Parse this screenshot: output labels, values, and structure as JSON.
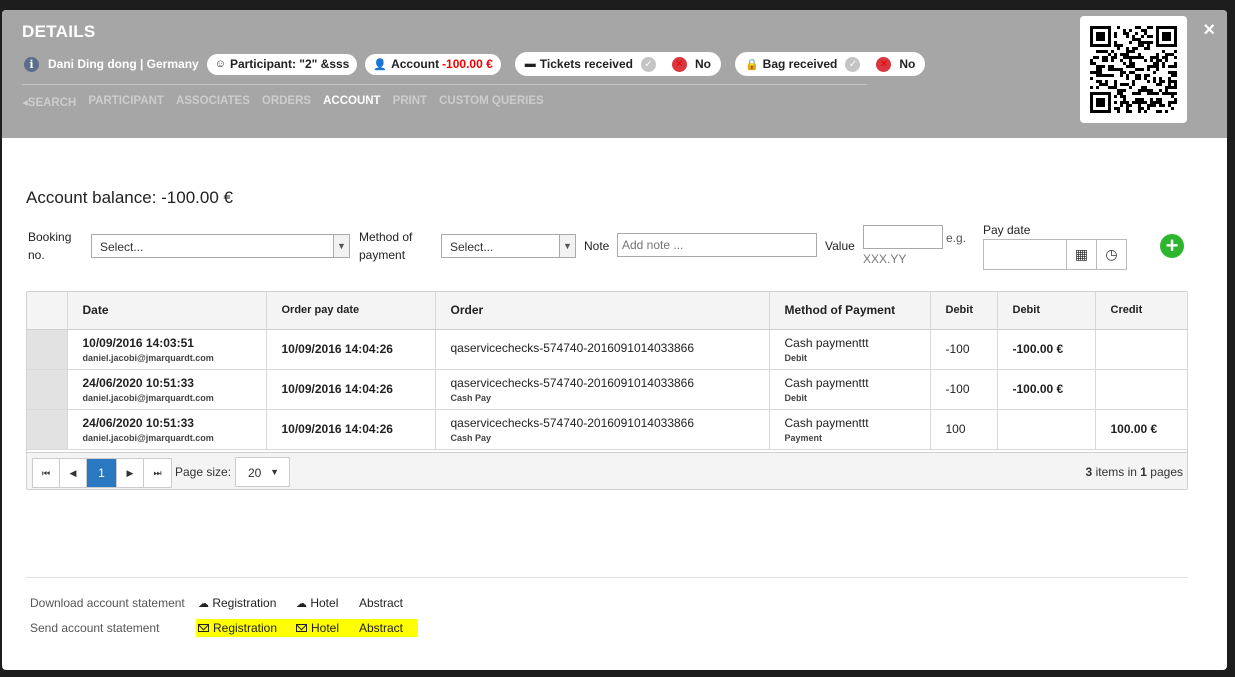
{
  "header": {
    "title": "DETAILS",
    "person": "Dani Ding dong | Germany",
    "participant_label": "Participant: \"2\" &sss",
    "account_label": "Account",
    "account_value": "-100.00 €",
    "tickets_label": "Tickets received",
    "tickets_value": "No",
    "bag_label": "Bag received",
    "bag_value": "No",
    "close": "×"
  },
  "nav": {
    "search": "SEARCH",
    "participant": "PARTICIPANT",
    "associates": "ASSOCIATES",
    "orders": "ORDERS",
    "account": "ACCOUNT",
    "print": "PRINT",
    "custom_queries": "CUSTOM QUERIES"
  },
  "balance": "Account balance: -100.00 €",
  "form": {
    "booking_label_1": "Booking",
    "booking_label_2": "no.",
    "booking_select": "Select...",
    "method_label_1": "Method of",
    "method_label_2": "payment",
    "method_select": "Select...",
    "note_label": "Note",
    "note_placeholder": "Add note ...",
    "value_label": "Value",
    "value_hint_1": "e.g.",
    "value_hint_2": "XXX.YY",
    "pay_date_label": "Pay date"
  },
  "table": {
    "headers": [
      "Date",
      "Order pay date",
      "Order",
      "Method of Payment",
      "Debit",
      "Debit",
      "Credit"
    ],
    "rows": [
      {
        "date": "10/09/2016 14:03:51",
        "user": "daniel.jacobi@jmarquardt.com",
        "pay_date": "10/09/2016 14:04:26",
        "order": "qaservicechecks-574740-2016091014033866",
        "order_sub": "",
        "method": "Cash paymenttt",
        "method_sub": "Debit",
        "debit_num": "-100",
        "debit_amount": "-100.00 €",
        "credit": ""
      },
      {
        "date": "24/06/2020 10:51:33",
        "user": "daniel.jacobi@jmarquardt.com",
        "pay_date": "10/09/2016 14:04:26",
        "order": "qaservicechecks-574740-2016091014033866",
        "order_sub": "Cash Pay",
        "method": "Cash paymenttt",
        "method_sub": "Debit",
        "debit_num": "-100",
        "debit_amount": "-100.00 €",
        "credit": ""
      },
      {
        "date": "24/06/2020 10:51:33",
        "user": "daniel.jacobi@jmarquardt.com",
        "pay_date": "10/09/2016 14:04:26",
        "order": "qaservicechecks-574740-2016091014033866",
        "order_sub": "Cash Pay",
        "method": "Cash paymenttt",
        "method_sub": "Payment",
        "debit_num": "100",
        "debit_amount": "",
        "credit": "100.00 €"
      }
    ]
  },
  "pager": {
    "current_page": "1",
    "page_size_label": "Page size:",
    "page_size": "20",
    "items_count": "3",
    "items_text": "items in",
    "pages_count": "1",
    "pages_text": "pages"
  },
  "statements": {
    "download_label": "Download account statement",
    "send_label": "Send account statement",
    "registration": "Registration",
    "hotel": "Hotel",
    "abstract": "Abstract"
  }
}
